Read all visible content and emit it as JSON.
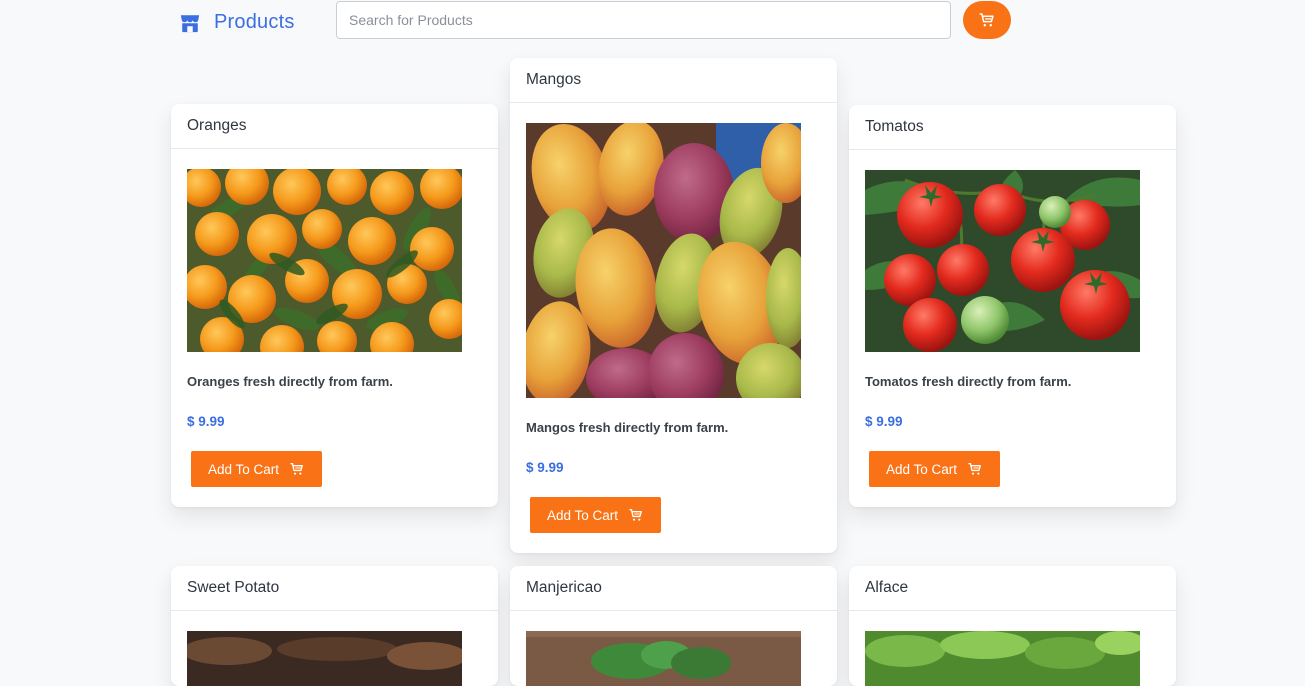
{
  "header": {
    "brand_label": "Products",
    "search_placeholder": "Search for Products"
  },
  "colors": {
    "accent": "#f97316",
    "brand": "#3b6ee0",
    "price": "#3b6ee0"
  },
  "products": [
    {
      "title": "Oranges",
      "description": "Oranges fresh directly from farm.",
      "price": "$ 9.99",
      "button_label": "Add To Cart",
      "image_icon": "oranges-image"
    },
    {
      "title": "Mangos",
      "description": "Mangos fresh directly from farm.",
      "price": "$ 9.99",
      "button_label": "Add To Cart",
      "image_icon": "mangos-image"
    },
    {
      "title": "Tomatos",
      "description": "Tomatos fresh directly from farm.",
      "price": "$ 9.99",
      "button_label": "Add To Cart",
      "image_icon": "tomatos-image"
    },
    {
      "title": "Sweet Potato",
      "image_icon": "sweet-potato-image"
    },
    {
      "title": "Manjericao",
      "image_icon": "manjericao-image"
    },
    {
      "title": "Alface",
      "image_icon": "alface-image"
    }
  ]
}
